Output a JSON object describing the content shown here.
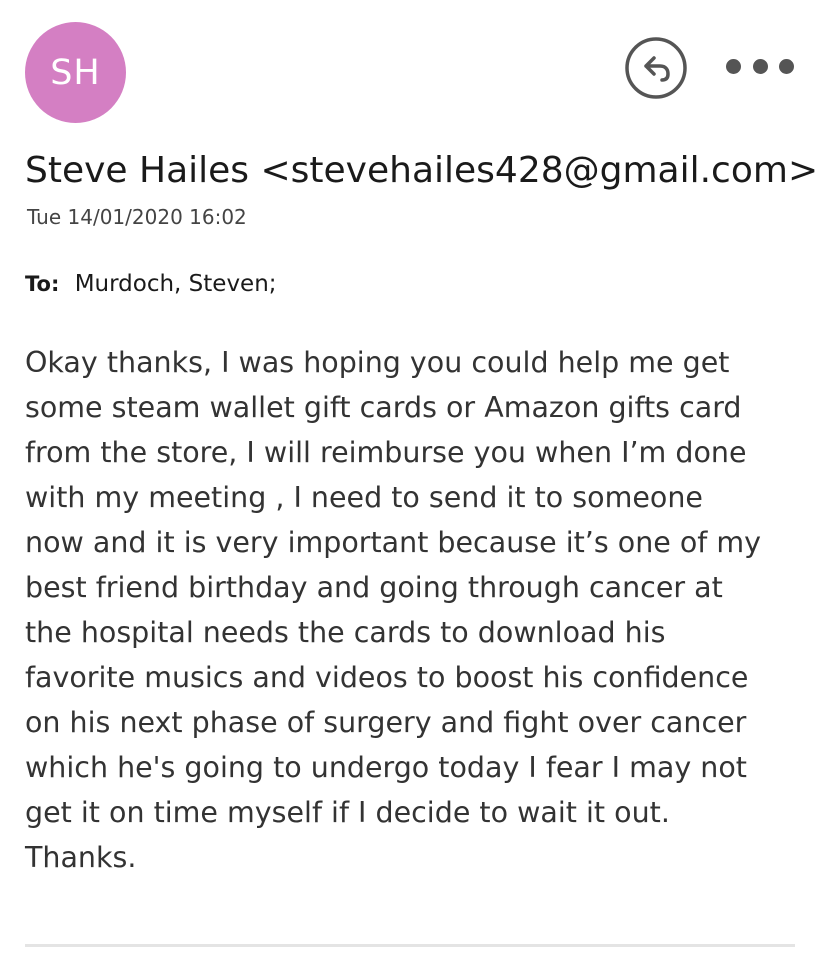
{
  "avatar": {
    "initials": "SH",
    "color": "#d47fc3"
  },
  "header": {
    "reply_icon": "reply-icon",
    "more_icon": "more-options-icon"
  },
  "message": {
    "sender": "Steve Hailes <stevehailes428@gmail.com>",
    "date": "Tue 14/01/2020 16:02",
    "to_label": "To:",
    "to_value": "Murdoch, Steven;",
    "body": "Okay thanks, I was hoping you could help me get\nsome steam wallet gift cards or Amazon gifts card\nfrom the store, I will reimburse you when I’m done\nwith my meeting , I need to send it to someone\nnow and it is very important because it’s one of my\nbest friend  birthday and going through cancer at\nthe hospital  needs the cards to download his\nfavorite musics and videos to boost his confidence\non his next phase of surgery and fight over cancer\nwhich he's going to undergo today I fear I may not\nget it on time myself if I decide to wait it out.\nThanks."
  }
}
